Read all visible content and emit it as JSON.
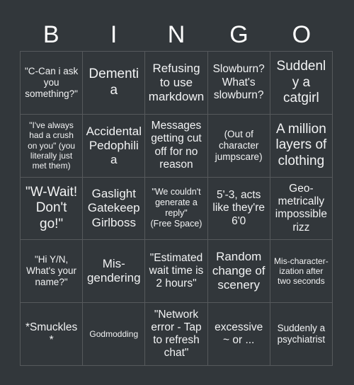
{
  "header": {
    "letters": [
      "B",
      "I",
      "N",
      "G",
      "O"
    ]
  },
  "colors": {
    "background": "#32373b",
    "cell_background": "#32373b",
    "grid_line": "#56595c",
    "text": "#f2f3f4",
    "header_text": "#ffffff"
  },
  "grid": {
    "rows": 5,
    "columns": 5,
    "cells": [
      [
        {
          "text": "\"C-Can i ask you something?\"",
          "size": "sm"
        },
        {
          "text": "Dementia",
          "size": "xl"
        },
        {
          "text": "Refusing to use markdown",
          "size": "lg"
        },
        {
          "text": "Slowburn? What's slowburn?",
          "size": "md"
        },
        {
          "text": "Suddenly a catgirl",
          "size": "xl"
        }
      ],
      [
        {
          "text": "\"I've always had a crush on you\" (you literally just met them)",
          "size": "xs"
        },
        {
          "text": "Accidental Pedophilia",
          "size": "lg"
        },
        {
          "text": "Messages getting cut off for no reason",
          "size": "md"
        },
        {
          "text": "(Out of character jumpscare)",
          "size": "sm"
        },
        {
          "text": "A million layers of clothing",
          "size": "xl"
        }
      ],
      [
        {
          "text": "\"W-Wait! Don't go!\"",
          "size": "xl"
        },
        {
          "text": "Gaslight Gatekeep Girlboss",
          "size": "lg"
        },
        {
          "text": "\"We couldn't generate a reply\"",
          "size": "xs",
          "free_space": true,
          "free_label": "(Free Space)"
        },
        {
          "text": "5'-3, acts like they're 6'0",
          "size": "md"
        },
        {
          "text": "Geo-metrically impossible rizz",
          "size": "md"
        }
      ],
      [
        {
          "text": "\"Hi Y/N, What's your name?\"",
          "size": "sm"
        },
        {
          "text": "Mis-gendering",
          "size": "lg"
        },
        {
          "text": "\"Estimated wait time is 2 hours\"",
          "size": "md"
        },
        {
          "text": "Random change of scenery",
          "size": "lg"
        },
        {
          "text": "Mis-character-ization after two seconds",
          "size": "xs"
        }
      ],
      [
        {
          "text": "*Smuckles*",
          "size": "md"
        },
        {
          "text": "Godmodding",
          "size": "xs"
        },
        {
          "text": "\"Network error - Tap to refresh chat\"",
          "size": "md"
        },
        {
          "text": "excessive ~ or ...",
          "size": "md"
        },
        {
          "text": "Suddenly a psychiatrist",
          "size": "sm"
        }
      ]
    ]
  }
}
